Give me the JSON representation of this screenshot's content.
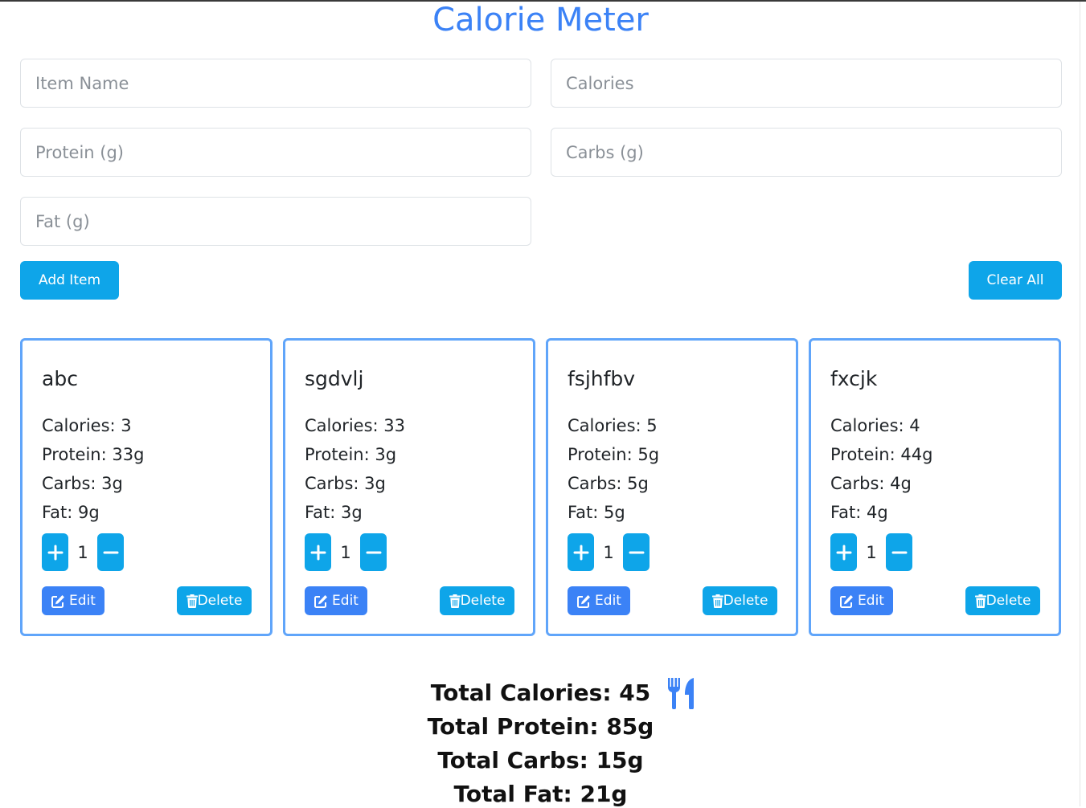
{
  "app": {
    "title": "Calorie Meter"
  },
  "form": {
    "item_name_placeholder": "Item Name",
    "calories_placeholder": "Calories",
    "protein_placeholder": "Protein (g)",
    "carbs_placeholder": "Carbs (g)",
    "fat_placeholder": "Fat (g)",
    "add_label": "Add Item",
    "clear_label": "Clear All"
  },
  "items": [
    {
      "name": "abc",
      "calories": "Calories: 3",
      "protein": "Protein: 33g",
      "carbs": "Carbs: 3g",
      "fat": "Fat: 9g",
      "quantity": "1",
      "edit_label": "Edit",
      "delete_label": "Delete"
    },
    {
      "name": "sgdvlj",
      "calories": "Calories: 33",
      "protein": "Protein: 3g",
      "carbs": "Carbs: 3g",
      "fat": "Fat: 3g",
      "quantity": "1",
      "edit_label": "Edit",
      "delete_label": "Delete"
    },
    {
      "name": "fsjhfbv",
      "calories": "Calories: 5",
      "protein": "Protein: 5g",
      "carbs": "Carbs: 5g",
      "fat": "Fat: 5g",
      "quantity": "1",
      "edit_label": "Edit",
      "delete_label": "Delete"
    },
    {
      "name": "fxcjk",
      "calories": "Calories: 4",
      "protein": "Protein: 44g",
      "carbs": "Carbs: 4g",
      "fat": "Fat: 4g",
      "quantity": "1",
      "edit_label": "Edit",
      "delete_label": "Delete"
    }
  ],
  "totals": {
    "calories": "Total Calories: 45",
    "protein": "Total Protein: 85g",
    "carbs": "Total Carbs: 15g",
    "fat": "Total Fat: 21g"
  },
  "icons": {
    "plus": "plus-icon",
    "minus": "minus-icon",
    "edit": "pen-to-square-icon",
    "delete": "trash-can-icon",
    "totals": "utensils-icon"
  },
  "colors": {
    "title": "#3b82f6",
    "primary_button": "#0ea5e9",
    "edit_button": "#3b82f6",
    "card_border": "#60a5fa"
  }
}
